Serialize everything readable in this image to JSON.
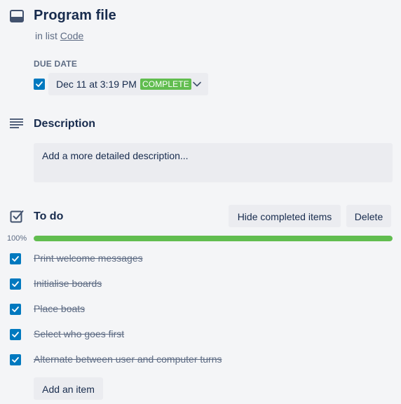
{
  "card": {
    "title": "Program file",
    "in_list_prefix": "in list",
    "list_name": "Code",
    "icon": "card-icon"
  },
  "due_date": {
    "label": "DUE DATE",
    "value": "Dec 11 at 3:19 PM",
    "badge": "COMPLETE",
    "checked": true
  },
  "description": {
    "heading": "Description",
    "placeholder": "Add a more detailed description..."
  },
  "checklist": {
    "heading": "To do",
    "hide_label": "Hide completed items",
    "delete_label": "Delete",
    "progress_text": "100%",
    "progress": 1.0,
    "items": [
      {
        "label": "Print welcome messages",
        "checked": true
      },
      {
        "label": "Initialise boards",
        "checked": true
      },
      {
        "label": "Place boats",
        "checked": true
      },
      {
        "label": "Select who goes first",
        "checked": true
      },
      {
        "label": "Alternate between user and computer turns",
        "checked": true
      }
    ],
    "add_label": "Add an item"
  },
  "colors": {
    "accent": "#0079bf",
    "success": "#61bd4f",
    "text": "#172b4d",
    "muted": "#5e6c84",
    "surface": "#ebecf0"
  }
}
